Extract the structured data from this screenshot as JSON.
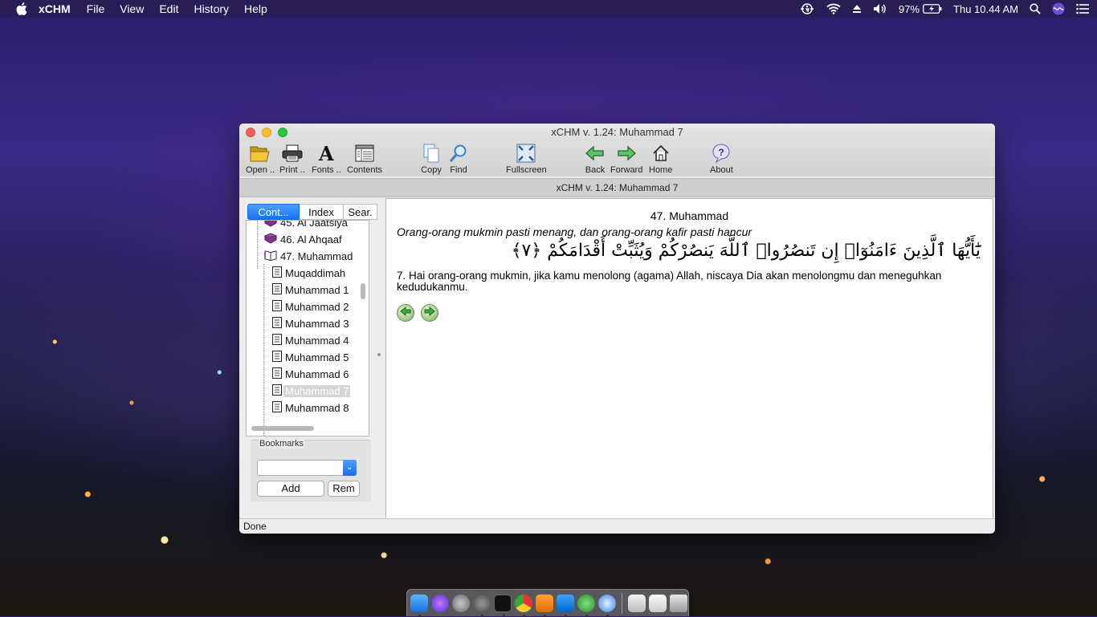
{
  "menubar": {
    "app_name": "xCHM",
    "items": [
      "File",
      "View",
      "Edit",
      "History",
      "Help"
    ],
    "battery": "97%",
    "clock": "Thu 10.44 AM"
  },
  "window": {
    "title": "xCHM v. 1.24: Muhammad 7",
    "subtitle": "xCHM v. 1.24: Muhammad 7",
    "toolbar": {
      "open": "Open ..",
      "print": "Print ..",
      "fonts": "Fonts ..",
      "contents": "Contents",
      "copy": "Copy",
      "find": "Find",
      "fullscreen": "Fullscreen",
      "back": "Back",
      "forward": "Forward",
      "home": "Home",
      "about": "About"
    },
    "tabs": {
      "contents": "Cont...",
      "index": "Index",
      "search": "Sear."
    },
    "tree": [
      {
        "label": "45. Al Jaatsiya",
        "icon": "book-icon"
      },
      {
        "label": "46. Al Ahqaaf",
        "icon": "book-icon"
      },
      {
        "label": "47. Muhammad",
        "icon": "open-book-icon"
      },
      {
        "label": "Muqaddimah",
        "icon": "page-icon"
      },
      {
        "label": "Muhammad 1",
        "icon": "page-icon"
      },
      {
        "label": "Muhammad 2",
        "icon": "page-icon"
      },
      {
        "label": "Muhammad 3",
        "icon": "page-icon"
      },
      {
        "label": "Muhammad 4",
        "icon": "page-icon"
      },
      {
        "label": "Muhammad 5",
        "icon": "page-icon"
      },
      {
        "label": "Muhammad 6",
        "icon": "page-icon"
      },
      {
        "label": "Muhammad 7",
        "icon": "page-icon",
        "selected": true
      },
      {
        "label": "Muhammad 8",
        "icon": "page-icon"
      }
    ],
    "bookmarks": {
      "label": "Bookmarks",
      "add": "Add",
      "remove": "Rem"
    },
    "content": {
      "title": "47. Muhammad",
      "subtitle": "Orang-orang mukmin pasti menang, dan orang-orang kafir pasti hancur",
      "arabic": "يَٰٓأَيُّهَا ٱلَّذِينَ ءَامَنُوٓا۟ إِن تَنصُرُوا۟ ٱللَّهَ يَنصُرْكُمْ وَيُثَبِّتْ أَقْدَامَكُمْ ﴿٧﴾",
      "translation": "7. Hai orang-orang mukmin, jika kamu menolong (agama) Allah, niscaya Dia akan menolongmu dan meneguhkan kedudukanmu."
    },
    "status": "Done"
  }
}
